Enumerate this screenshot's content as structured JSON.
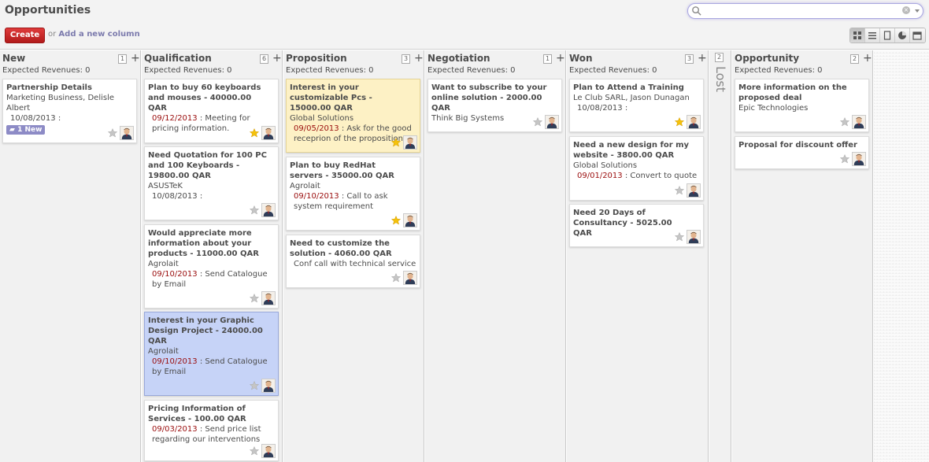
{
  "header": {
    "title": "Opportunities",
    "create_label": "Create",
    "or_text": "or",
    "add_column_label": "Add a new column",
    "search_placeholder": ""
  },
  "columns": [
    {
      "title": "New",
      "revenue": "Expected Revenues: 0",
      "count": "1",
      "cards": [
        {
          "title": "Partnership Details",
          "lines": [
            "Marketing Business, Delisle",
            "Albert"
          ],
          "date": "10/08/2013",
          "note": " :",
          "badge": "1 New",
          "starred": false,
          "color": "white"
        }
      ]
    },
    {
      "title": "Qualification",
      "revenue": "Expected Revenues: 0",
      "count": "6",
      "cards": [
        {
          "title": "Plan to buy 60 keyboards and mouses - 40000.00 QAR",
          "lines": [],
          "date": "09/12/2013",
          "note": " : Meeting for pricing information.",
          "starred": true,
          "color": "white",
          "date_red": true
        },
        {
          "title": "Need Quotation for 100 PC and 100 Keyboards - 19800.00 QAR",
          "lines": [
            "ASUSTeK"
          ],
          "date": "10/08/2013",
          "note": " :",
          "starred": false,
          "color": "white"
        },
        {
          "title": "Would appreciate more information about your products - 11000.00 QAR",
          "lines": [
            "Agrolait"
          ],
          "date": "09/10/2013",
          "note": " : Send Catalogue by Email",
          "starred": false,
          "color": "white",
          "date_red": true
        },
        {
          "title": "Interest in your Graphic Design Project - 24000.00 QAR",
          "lines": [
            "Agrolait"
          ],
          "date": "09/10/2013",
          "note": " : Send Catalogue by Email",
          "starred": false,
          "color": "blue",
          "date_red": true
        },
        {
          "title": "Pricing Information of Services - 100.00 QAR",
          "lines": [],
          "date": "09/03/2013",
          "note": " : Send price list regarding our interventions",
          "starred": false,
          "color": "white",
          "date_red": true
        }
      ]
    },
    {
      "title": "Proposition",
      "revenue": "Expected Revenues: 0",
      "count": "3",
      "cards": [
        {
          "title": "Interest in your customizable Pcs - 15000.00 QAR",
          "lines": [
            "Global Solutions"
          ],
          "date": "09/05/2013",
          "note": " : Ask for the good receprion of the proposition",
          "starred": true,
          "color": "yellow",
          "date_red": true
        },
        {
          "title": "Plan to buy RedHat servers - 35000.00 QAR",
          "lines": [
            "Agrolait"
          ],
          "date": "09/10/2013",
          "note": " : Call to ask system requirement",
          "starred": true,
          "color": "white",
          "date_red": true
        },
        {
          "title": "Need to customize the solution - 4060.00 QAR",
          "lines": [],
          "date": "",
          "note": "Conf call with technical service",
          "starred": false,
          "color": "white"
        }
      ]
    },
    {
      "title": "Negotiation",
      "revenue": "Expected Revenues: 0",
      "count": "1",
      "cards": [
        {
          "title": "Want to subscribe to your online solution - 2000.00 QAR",
          "lines": [
            "Think Big Systems"
          ],
          "date": "",
          "note": "",
          "starred": false,
          "color": "white"
        }
      ]
    },
    {
      "title": "Won",
      "revenue": "Expected Revenues: 0",
      "count": "3",
      "cards": [
        {
          "title": "Plan to Attend a Training",
          "lines": [
            "Le Club SARL, Jason Dunagan"
          ],
          "date": "10/08/2013",
          "note": " :",
          "starred": true,
          "color": "white"
        },
        {
          "title": "Need a new design for my website - 3800.00 QAR",
          "lines": [
            "Global Solutions"
          ],
          "date": "09/01/2013",
          "note": " : Convert to quote",
          "starred": false,
          "color": "white",
          "date_red": true
        },
        {
          "title": "Need 20 Days of Consultancy - 5025.00 QAR",
          "lines": [],
          "date": "",
          "note": "",
          "starred": false,
          "color": "white"
        }
      ]
    },
    {
      "title": "Opportunity",
      "revenue": "Expected Revenues: 0",
      "count": "2",
      "cards": [
        {
          "title": "More information on the proposed deal",
          "lines": [
            "Epic Technologies"
          ],
          "date": "",
          "note": "",
          "starred": false,
          "color": "white"
        },
        {
          "title": "Proposal for discount offer",
          "lines": [],
          "date": "",
          "note": "",
          "starred": false,
          "color": "white"
        }
      ]
    }
  ],
  "lost": {
    "label": "Lost",
    "count": "2"
  },
  "colors": {
    "accent": "#7c7bad",
    "create": "#c92a2a",
    "date_red": "#9a0d0d",
    "card_yellow": "#fdf1c5",
    "card_blue": "#c6d3f7",
    "star_active": "#f5c20b"
  }
}
